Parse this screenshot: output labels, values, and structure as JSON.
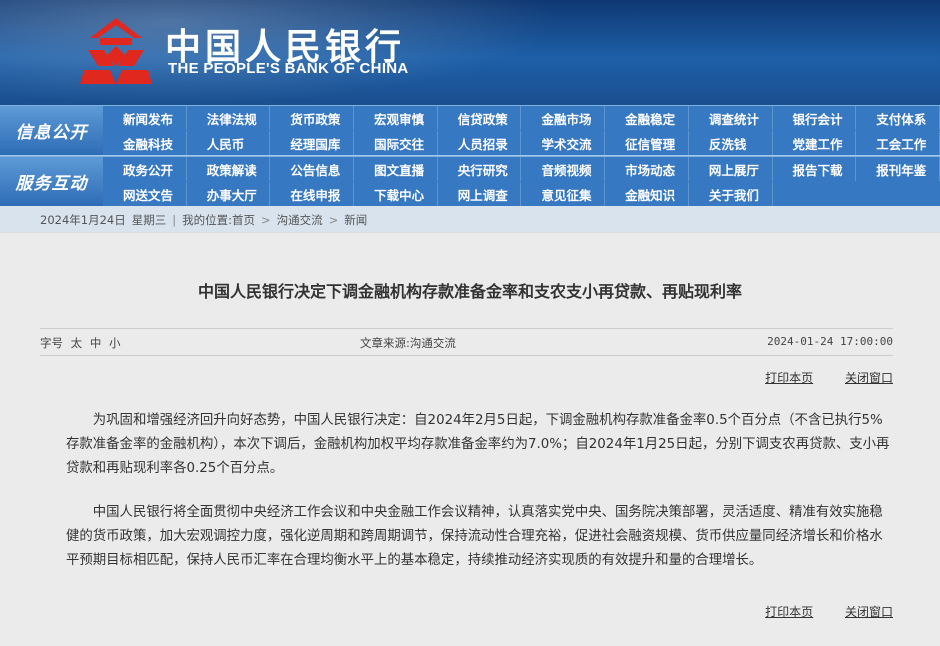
{
  "brand": {
    "cn": "中国人民银行",
    "en": "THE PEOPLE'S BANK OF CHINA",
    "logo_color": "#e0281e"
  },
  "nav": {
    "row1": {
      "side": "信息公开",
      "items": [
        "新闻发布",
        "法律法规",
        "货币政策",
        "宏观审慎",
        "信贷政策",
        "金融市场",
        "金融稳定",
        "调查统计",
        "银行会计",
        "支付体系",
        "金融科技",
        "人民币",
        "经理国库",
        "国际交往",
        "人员招录",
        "学术交流",
        "征信管理",
        "反洗钱",
        "党建工作",
        "工会工作"
      ]
    },
    "row2": {
      "side": "服务互动",
      "items": [
        "政务公开",
        "政策解读",
        "公告信息",
        "图文直播",
        "央行研究",
        "音频视频",
        "市场动态",
        "网上展厅",
        "报告下载",
        "报刊年鉴",
        "网送文告",
        "办事大厅",
        "在线申报",
        "下载中心",
        "网上调查",
        "意见征集",
        "金融知识",
        "关于我们"
      ]
    }
  },
  "breadcrumb": {
    "date": "2024年1月24日",
    "weekday": "星期三",
    "location_label": "我的位置:首页",
    "level1": "沟通交流",
    "level2": "新闻"
  },
  "article": {
    "title": "中国人民银行决定下调金融机构存款准备金率和支农支小再贷款、再贴现利率",
    "font_size_label": "字号",
    "size_large": "太",
    "size_medium": "中",
    "size_small": "小",
    "source": "文章来源:沟通交流",
    "datetime": "2024-01-24 17:00:00",
    "print_label": "打印本页",
    "close_label": "关闭窗口",
    "paragraphs": [
      "　　为巩固和增强经济回升向好态势，中国人民银行决定：自2024年2月5日起，下调金融机构存款准备金率0.5个百分点（不含已执行5%存款准备金率的金融机构），本次下调后，金融机构加权平均存款准备金率约为7.0%；自2024年1月25日起，分别下调支农再贷款、支小再贷款和再贴现利率各0.25个百分点。",
      "　　中国人民银行将全面贯彻中央经济工作会议和中央金融工作会议精神，认真落实党中央、国务院决策部署，灵活适度、精准有效实施稳健的货币政策，加大宏观调控力度，强化逆周期和跨周期调节，保持流动性合理充裕，促进社会融资规模、货币供应量同经济增长和价格水平预期目标相匹配，保持人民币汇率在合理均衡水平上的基本稳定，持续推动经济实现质的有效提升和量的合理增长。"
    ]
  }
}
